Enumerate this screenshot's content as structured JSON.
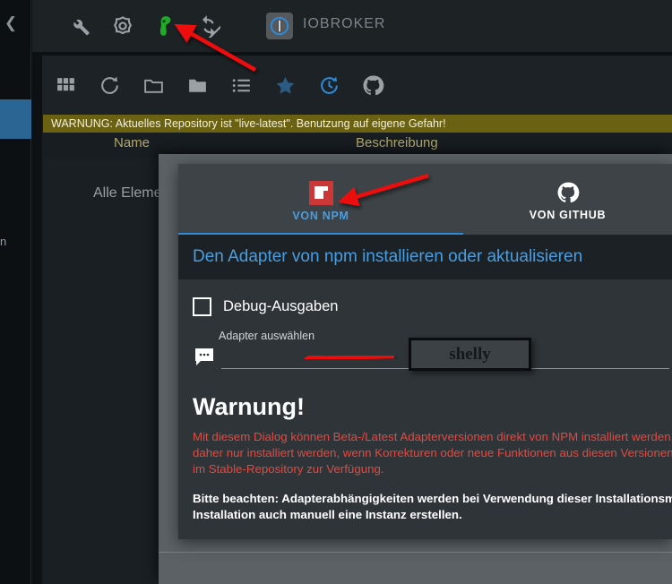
{
  "sidebar": {
    "collapse_icon": "chevron-left-icon",
    "partial_label": "n"
  },
  "appbar": {
    "icons": [
      {
        "name": "wrench-icon",
        "label": "Wrench"
      },
      {
        "name": "gear-icon",
        "label": "Einstellungen"
      },
      {
        "name": "green-bug-icon",
        "label": "Status"
      },
      {
        "name": "sync-disabled-icon",
        "label": "Sync aus"
      }
    ],
    "logo_icon": "iobroker-logo-icon",
    "brand": "IOBROKER"
  },
  "toolbar": {
    "icons": [
      {
        "name": "grid-view-icon",
        "label": "Kachelansicht"
      },
      {
        "name": "refresh-icon",
        "label": "Aktualisieren"
      },
      {
        "name": "folder-open-icon",
        "label": "Alle aufklappen"
      },
      {
        "name": "folder-closed-icon",
        "label": "Alle zuklappen"
      },
      {
        "name": "list-view-icon",
        "label": "Listenansicht"
      },
      {
        "name": "star-icon",
        "label": "Favoriten"
      },
      {
        "name": "update-history-icon",
        "label": "Updates"
      },
      {
        "name": "github-icon",
        "label": "Von GitHub installieren"
      }
    ]
  },
  "repo_warning": "WARNUNG: Aktuelles Repository ist \"live-latest\". Benutzung auf eigene Gefahr!",
  "table": {
    "columns": [
      "Name",
      "Beschreibung"
    ],
    "rows": [
      {
        "name": "Alle Elemente"
      }
    ]
  },
  "dialog": {
    "tabs": [
      {
        "label": "VON NPM",
        "icon": "npm-logo-icon",
        "active": true
      },
      {
        "label": "VON GITHUB",
        "icon": "github-icon",
        "active": false
      }
    ],
    "title": "Den Adapter von npm installieren oder aktualisieren",
    "debug_checkbox": {
      "label": "Debug-Ausgaben",
      "checked": false
    },
    "adapter_field": {
      "caption": "Adapter auswählen",
      "value": "",
      "placeholder": "",
      "icon": "chat-bubble-icon"
    },
    "warning": {
      "heading": "Warnung!",
      "red_lines": [
        "Mit diesem Dialog können Beta-/Latest Adapterversionen direkt von NPM installiert werden. Diese Ve",
        "daher nur installiert werden, wenn Korrekturen oder neue Funktionen aus diesen Versionen benötigt w",
        "im Stable-Repository zur Verfügung."
      ],
      "white_lines": [
        "Bitte beachten: Adapterabhängigkeiten werden bei Verwendung dieser Installationsmethode nicht üb",
        "Installation auch manuell eine Instanz erstellen."
      ]
    }
  },
  "annotations": {
    "callout_text": "shelly",
    "arrows": [
      {
        "name": "arrow-to-green-bug-icon"
      },
      {
        "name": "arrow-to-npm-tab"
      },
      {
        "name": "arrow-to-adapter-input"
      }
    ]
  },
  "colors": {
    "accent_blue": "#4a9ee0",
    "warning_yellow": "#6b6112",
    "error_red": "#e04a42",
    "npm_red": "#cb3837",
    "backdrop_gray": "#5b6165"
  }
}
